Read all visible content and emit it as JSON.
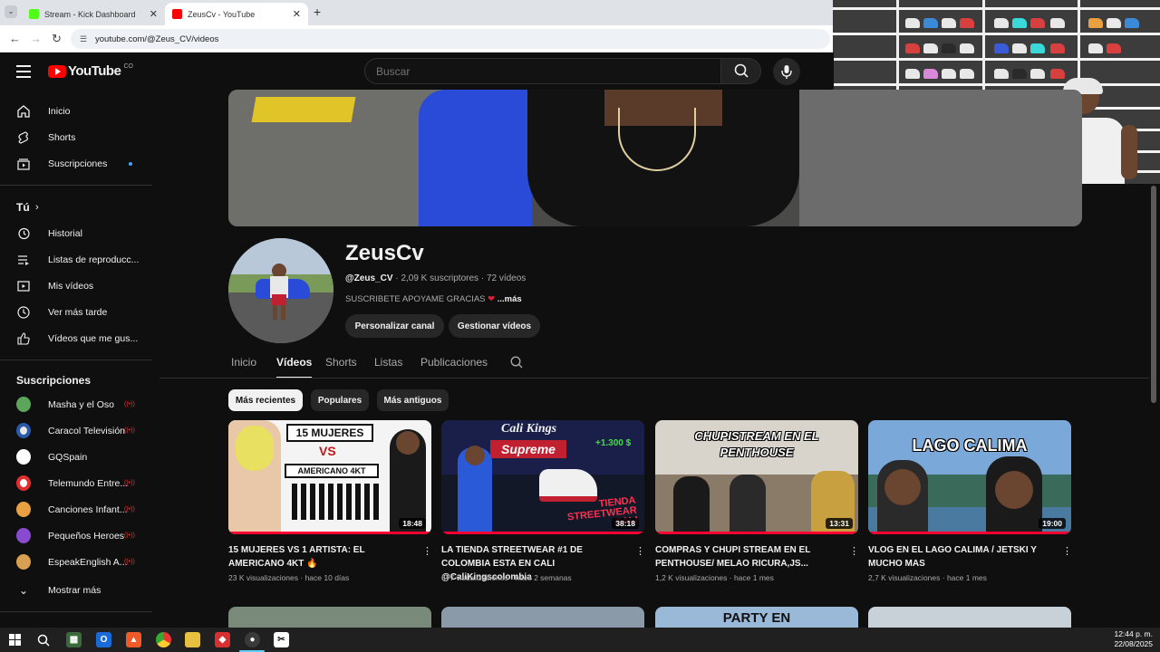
{
  "browser": {
    "tabs": [
      {
        "title": "Stream - Kick Dashboard",
        "favicon_color": "#53fc18"
      },
      {
        "title": "ZeusCv - YouTube",
        "favicon_color": "#ff0000"
      }
    ],
    "url": "youtube.com/@Zeus_CV/videos"
  },
  "youtube": {
    "logo_text": "YouTube",
    "country_code": "CO",
    "search_placeholder": "Buscar"
  },
  "sidebar": {
    "main": [
      {
        "label": "Inicio",
        "icon": "home-icon"
      },
      {
        "label": "Shorts",
        "icon": "shorts-icon"
      },
      {
        "label": "Suscripciones",
        "icon": "subscriptions-icon"
      }
    ],
    "you_header": "Tú",
    "you": [
      {
        "label": "Historial",
        "icon": "history-icon"
      },
      {
        "label": "Listas de reproducc...",
        "icon": "playlist-icon"
      },
      {
        "label": "Mis vídeos",
        "icon": "my-videos-icon"
      },
      {
        "label": "Ver más tarde",
        "icon": "watch-later-icon"
      },
      {
        "label": "Vídeos que me gus...",
        "icon": "like-icon"
      }
    ],
    "subs_header": "Suscripciones",
    "subs": [
      {
        "label": "Masha y el Oso",
        "color": "#5aa65a"
      },
      {
        "label": "Caracol Televisión",
        "color": "#2b5aa8"
      },
      {
        "label": "GQSpain",
        "color": "#ffffff"
      },
      {
        "label": "Telemundo Entre...",
        "color": "#e03030"
      },
      {
        "label": "Canciones Infant...",
        "color": "#e8a040"
      },
      {
        "label": "Pequeños Heroes",
        "color": "#8a4ad0"
      },
      {
        "label": "EspeakEnglish A...",
        "color": "#d8a050"
      }
    ],
    "show_more": "Mostrar más"
  },
  "channel": {
    "name": "ZeusCv",
    "handle": "@Zeus_CV",
    "subscribers": "2,09 K suscriptores",
    "videos_count": "72 vídeos",
    "description": "SUSCRIBETE APOYAME GRACIAS",
    "description_emoji": "❤",
    "more_label": "...más",
    "buttons": [
      "Personalizar canal",
      "Gestionar vídeos"
    ],
    "tabs": [
      "Inicio",
      "Vídeos",
      "Shorts",
      "Listas",
      "Publicaciones"
    ],
    "active_tab": "Vídeos",
    "chips": [
      "Más recientes",
      "Populares",
      "Más antiguos"
    ]
  },
  "videos": [
    {
      "title": "15 MUJERES VS 1 ARTISTA: EL AMERICANO 4KT 🔥",
      "duration": "18:48",
      "views": "23 K visualizaciones",
      "age": "hace 10 días",
      "thumb_text": [
        "15 MUJERES",
        "VS",
        "AMERICANO 4KT"
      ],
      "thumb_colors": [
        "#ffffff",
        "#e8e8e8"
      ]
    },
    {
      "title": "LA TIENDA STREETWEAR #1 DE COLOMBIA ESTA EN CALI @CaliKingscolombia",
      "duration": "38:18",
      "views": "677 visualizaciones",
      "age": "hace 2 semanas",
      "thumb_text": [
        "Cali Kings",
        "Supreme",
        "TIENDA STREETWEAR CALI",
        "+1.300 $"
      ],
      "thumb_colors": [
        "#1a1f4a",
        "#c02030"
      ]
    },
    {
      "title": "COMPRAS Y CHUPI STREAM EN EL PENTHOUSE/ MELAO RICURA,JS...",
      "duration": "13:31",
      "views": "1,2 K visualizaciones",
      "age": "hace 1 mes",
      "thumb_text": [
        "CHUPISTREAM EN EL",
        "PENTHOUSE"
      ],
      "thumb_colors": [
        "#d8d4cc",
        "#6a5a48"
      ]
    },
    {
      "title": "VLOG EN EL LAGO CALIMA / JETSKI Y MUCHO MAS",
      "duration": "19:00",
      "views": "2,7 K visualizaciones",
      "age": "hace 1 mes",
      "thumb_text": [
        "LAGO CALIMA"
      ],
      "thumb_colors": [
        "#7aa8d8",
        "#3a6a5a"
      ]
    }
  ],
  "next_row_partial_text": "PARTY EN",
  "taskbar": {
    "time": "12:44 p. m.",
    "date": "22/08/2025"
  }
}
